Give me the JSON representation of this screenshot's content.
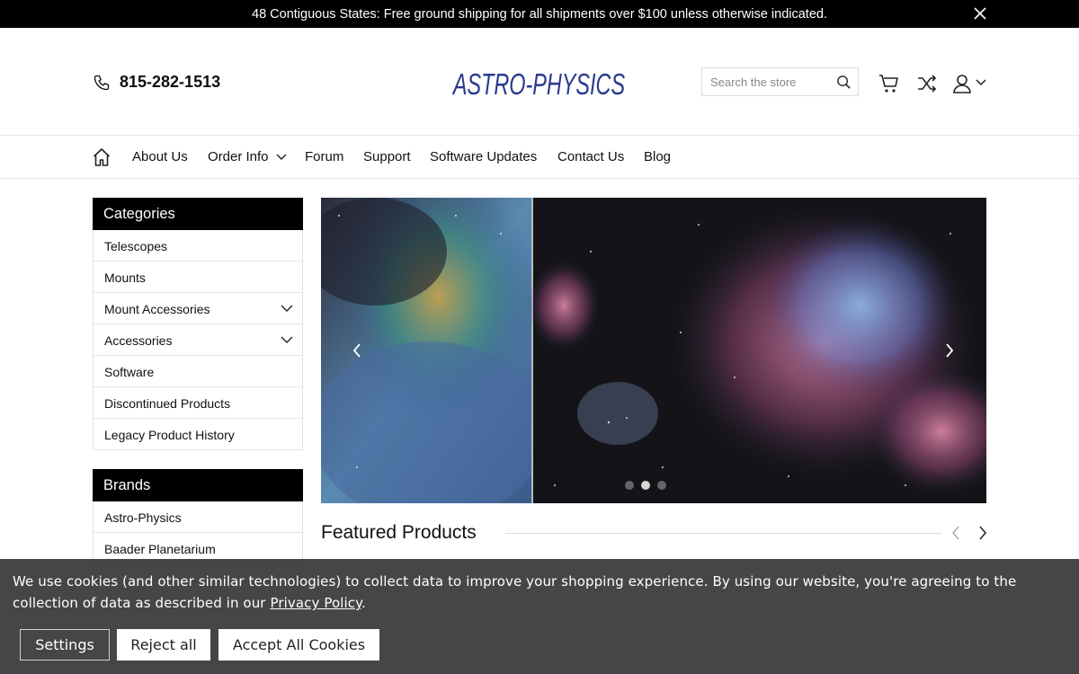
{
  "topbar": {
    "text": "48 Contiguous States: Free ground shipping for all shipments over $100 unless otherwise indicated."
  },
  "header": {
    "phone": "815-282-1513",
    "logo_text": "ASTRO-PHYSICS",
    "search_placeholder": "Search the store",
    "brand_color": "#2a3a8f"
  },
  "nav": {
    "items": [
      {
        "label": "About Us"
      },
      {
        "label": "Order Info"
      },
      {
        "label": "Forum"
      },
      {
        "label": "Support"
      },
      {
        "label": "Software Updates"
      },
      {
        "label": "Contact Us"
      },
      {
        "label": "Blog"
      }
    ]
  },
  "categories": {
    "heading": "Categories",
    "items": [
      {
        "label": "Telescopes"
      },
      {
        "label": "Mounts"
      },
      {
        "label": "Mount Accessories"
      },
      {
        "label": "Accessories"
      },
      {
        "label": "Software"
      },
      {
        "label": "Discontinued Products"
      },
      {
        "label": "Legacy Product History"
      }
    ]
  },
  "brands": {
    "heading": "Brands",
    "items": [
      {
        "label": "Astro-Physics"
      },
      {
        "label": "Baader Planetarium"
      }
    ]
  },
  "hero": {
    "slide_count": 3,
    "active_slide": 2
  },
  "featured": {
    "title": "Featured Products"
  },
  "cookie": {
    "message": "We use cookies (and other similar technologies) to collect data to improve your shopping experience. By using our website, you're agreeing to the collection of data as described in our ",
    "link": "Privacy Policy",
    "period": ".",
    "settings": "Settings",
    "reject": "Reject all",
    "accept": "Accept All Cookies"
  }
}
